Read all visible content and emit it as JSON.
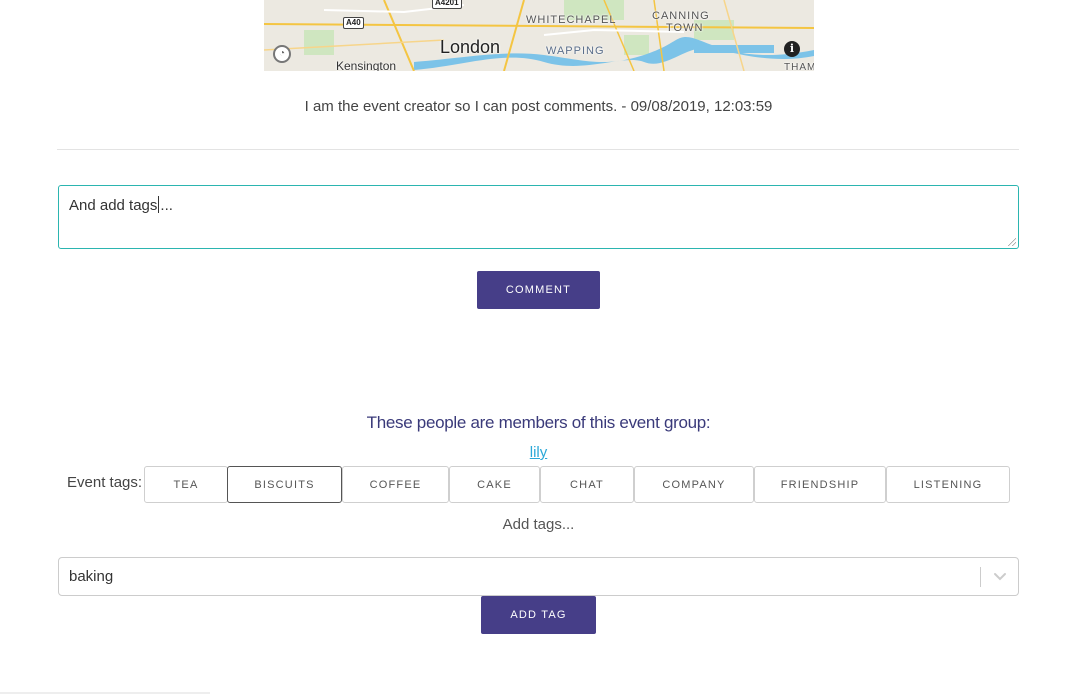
{
  "map": {
    "labels": {
      "london": "London",
      "whitechapel": "WHITECHAPEL",
      "canning_line1": "CANNING",
      "canning_line2": "TOWN",
      "wapping": "WAPPING",
      "kensington": "Kensington",
      "thar": "THAM"
    },
    "road_shields": {
      "a40": "A40",
      "a4201": "A4201"
    },
    "info_icon": "info-icon",
    "logo_icon": "mapbox-logo-icon"
  },
  "comment": {
    "text": "I am the event creator so I can post comments. - 09/08/2019, 12:03:59"
  },
  "comment_input": {
    "value_before_cursor": "And add tags",
    "value_after_cursor": "..."
  },
  "buttons": {
    "comment": "COMMENT",
    "add_tag": "ADD TAG"
  },
  "members": {
    "heading": "These people are members of this event group:",
    "list": [
      "lily"
    ]
  },
  "event_tags": {
    "label": "Event tags:",
    "tags": [
      "TEA",
      "BISCUITS",
      "COFFEE",
      "CAKE",
      "CHAT",
      "COMPANY",
      "FRIENDSHIP",
      "LISTENING"
    ],
    "active_tag": "BISCUITS"
  },
  "add_tags": {
    "label": "Add tags...",
    "select_value": "baking"
  },
  "colors": {
    "primary_button": "#463e88",
    "input_focus_border": "#2bb5b0",
    "heading_text": "#3a3a7a",
    "link": "#2aa8d8"
  }
}
